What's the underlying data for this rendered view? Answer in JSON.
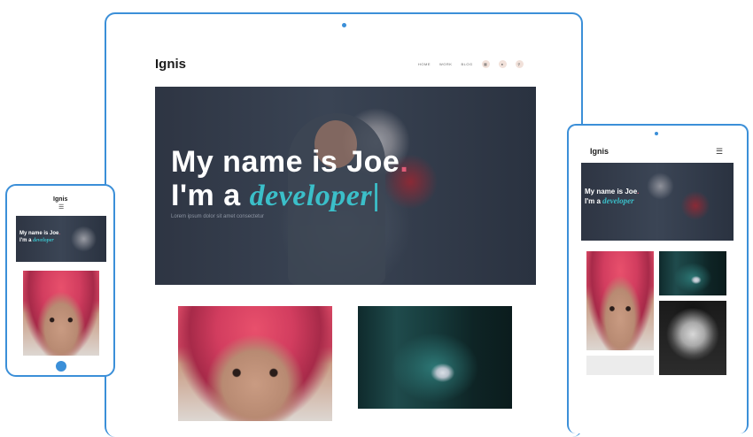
{
  "brand": "Ignis",
  "nav": {
    "items": [
      "HOME",
      "WORK",
      "BLOG"
    ]
  },
  "hero": {
    "line1_text": "My name is Joe",
    "line1_mark": ".",
    "line2_prefix": "I'm a",
    "line2_accent": "developer",
    "caret": "|",
    "subtitle": "Lorem ipsum dolor sit amet consectetur"
  },
  "icons": {
    "bag": "shopping-bag-icon",
    "user": "user-icon",
    "search": "search-icon",
    "menu": "hamburger-menu-icon"
  },
  "colors": {
    "frame": "#3b8fd8",
    "accent": "#3bbfc9",
    "mark": "#e05b77",
    "hero_bg": "#2e3543"
  }
}
